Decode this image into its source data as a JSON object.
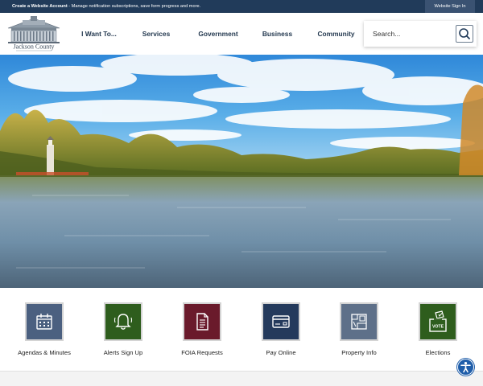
{
  "topbar": {
    "create_account_link": "Create a Website Account",
    "create_account_desc": " - Manage notification subscriptions, save form progress and more.",
    "sign_in_label": "Website Sign In"
  },
  "header": {
    "logo_text": "Jackson County",
    "nav": [
      {
        "label": "I Want To..."
      },
      {
        "label": "Services"
      },
      {
        "label": "Government"
      },
      {
        "label": "Business"
      },
      {
        "label": "Community"
      }
    ],
    "search": {
      "placeholder": "Search..."
    }
  },
  "hero": {
    "alt": "river scene with lighthouse and autumn trees"
  },
  "quick_links": [
    {
      "label": "Agendas & Minutes",
      "icon": "calendar-icon",
      "color": "#4b6080"
    },
    {
      "label": "Alerts Sign Up",
      "icon": "bell-icon",
      "color": "#2e5d1d"
    },
    {
      "label": "FOIA Requests",
      "icon": "document-icon",
      "color": "#6a1a2b"
    },
    {
      "label": "Pay Online",
      "icon": "credit-card-icon",
      "color": "#243a5c"
    },
    {
      "label": "Property Info",
      "icon": "map-icon",
      "color": "#5e7089"
    },
    {
      "label": "Elections",
      "icon": "ballot-box-icon",
      "color": "#2e5d1d",
      "badge": "VOTE"
    }
  ],
  "colors": {
    "topbar": "#213b5a",
    "nav_text": "#23384f",
    "accessibility": "#1f5eaa"
  }
}
